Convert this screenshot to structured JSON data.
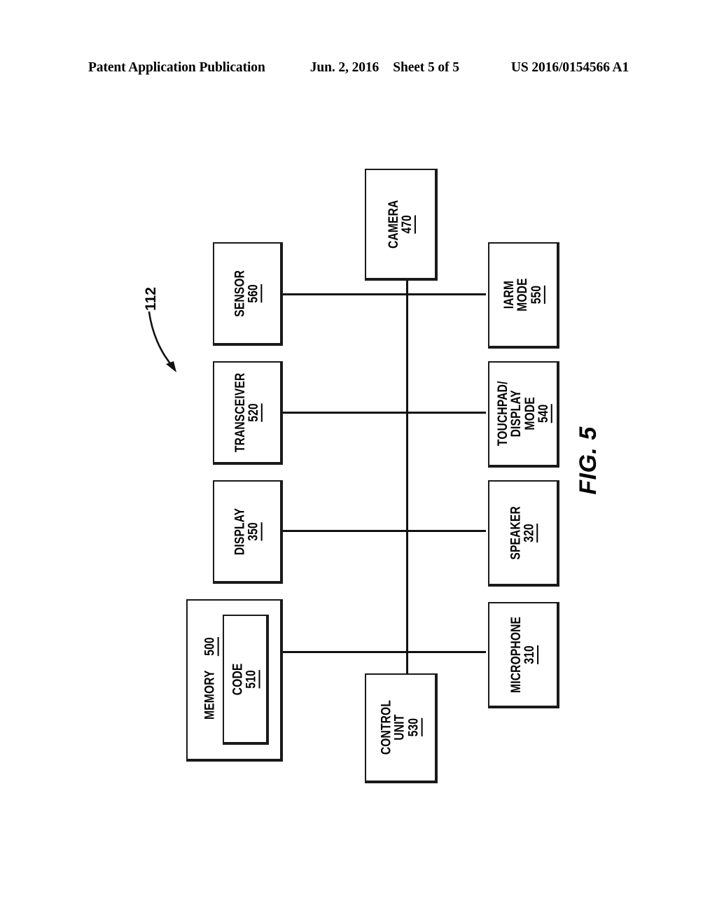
{
  "header": {
    "publication": "Patent Application Publication",
    "date": "Jun. 2, 2016",
    "sheet": "Sheet 5 of 5",
    "pub_number": "US 2016/0154566 A1"
  },
  "figure": {
    "caption": "FIG. 5",
    "assembly_ref": "112",
    "blocks": [
      {
        "id": "camera",
        "lines": [
          "CAMERA"
        ],
        "ref": "470"
      },
      {
        "id": "sensor",
        "lines": [
          "SENSOR"
        ],
        "ref": "560"
      },
      {
        "id": "alarm_mode",
        "lines": [
          "IARM",
          "MODE"
        ],
        "ref": "550"
      },
      {
        "id": "transceiver",
        "lines": [
          "TRANSCEIVER"
        ],
        "ref": "520"
      },
      {
        "id": "touchpad_mode",
        "lines": [
          "TOUCHPAD/",
          "DISPLAY",
          "MODE"
        ],
        "ref": "540"
      },
      {
        "id": "display",
        "lines": [
          "DISPLAY"
        ],
        "ref": "350"
      },
      {
        "id": "speaker",
        "lines": [
          "SPEAKER"
        ],
        "ref": "320"
      },
      {
        "id": "memory",
        "lines": [
          "MEMORY"
        ],
        "ref": "500"
      },
      {
        "id": "code",
        "lines": [
          "CODE"
        ],
        "ref": "510"
      },
      {
        "id": "microphone",
        "lines": [
          "MICROPHONE"
        ],
        "ref": "310"
      },
      {
        "id": "control_unit",
        "lines": [
          "CONTROL",
          "UNIT"
        ],
        "ref": "530"
      }
    ],
    "colors": {
      "line": "#111111",
      "box_border": "#1a1a1a",
      "background": "#ffffff"
    }
  }
}
